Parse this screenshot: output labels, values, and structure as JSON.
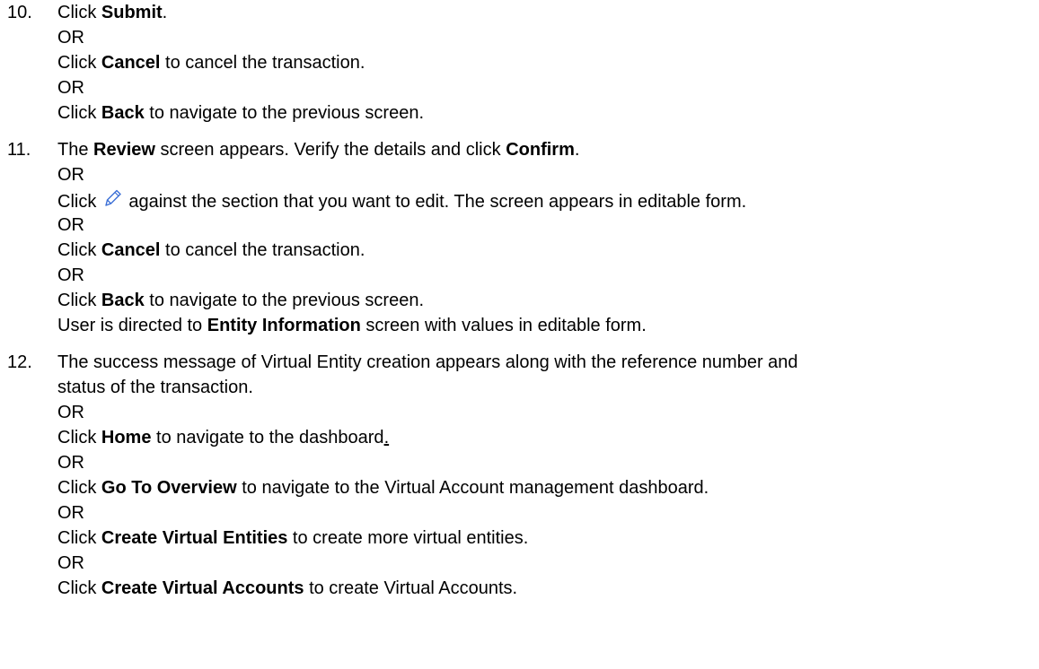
{
  "steps": [
    {
      "number": "10.",
      "lines": [
        {
          "pre": "Click ",
          "bold": "Submit",
          "post": "."
        },
        {
          "text": "OR"
        },
        {
          "pre": "Click ",
          "bold": "Cancel",
          "post": " to cancel the transaction."
        },
        {
          "text": "OR"
        },
        {
          "pre": "Click ",
          "bold": "Back",
          "post": " to navigate to the previous screen."
        }
      ]
    },
    {
      "number": "11.",
      "lines": [
        {
          "pre": "The ",
          "bold": "Review",
          "mid": " screen appears. Verify the details and click ",
          "bold2": "Confirm",
          "post": "."
        },
        {
          "text": "OR"
        },
        {
          "pre": "Click",
          "post": "against the section that you want to edit. The screen appears in editable form."
        },
        {
          "text": "OR"
        },
        {
          "pre": "Click ",
          "bold": "Cancel",
          "post": " to cancel the transaction."
        },
        {
          "text": "OR"
        },
        {
          "pre": "Click ",
          "bold": "Back",
          "post": " to navigate to the previous screen."
        },
        {
          "pre": "User is directed to ",
          "bold": "Entity Information",
          "post": " screen with values in editable form."
        }
      ]
    },
    {
      "number": "12.",
      "lines": [
        {
          "text": "The success message of Virtual Entity creation appears along with the reference number and"
        },
        {
          "text": "status of the transaction."
        },
        {
          "text": "OR"
        },
        {
          "pre": "Click ",
          "bold": "Home",
          "post": " to navigate to the dashboard",
          "underlined": "."
        },
        {
          "text": "OR"
        },
        {
          "pre": "Click ",
          "bold": "Go To Overview",
          "post": " to navigate to the Virtual Account management dashboard."
        },
        {
          "text": "OR"
        },
        {
          "pre": "Click ",
          "bold": "Create Virtual Entities",
          "post": " to create more virtual entities."
        },
        {
          "text": "OR"
        },
        {
          "pre": "Click ",
          "bold": "Create Virtual Accounts",
          "post": " to create Virtual Accounts."
        }
      ]
    }
  ],
  "icons": {
    "edit": "pencil-icon",
    "edit_color": "#3b6fd6"
  }
}
